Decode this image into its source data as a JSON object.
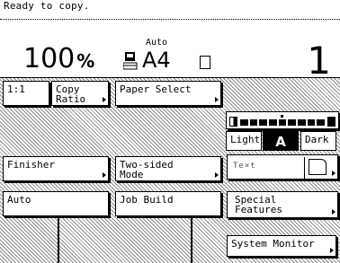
{
  "status": {
    "message": "Ready to copy."
  },
  "info": {
    "zoom_value": "100",
    "zoom_unit": "%",
    "paper_select_mode": "Auto",
    "paper_size": "A4",
    "copies": "1"
  },
  "buttons": {
    "one_to_one": "1:1",
    "copy_ratio": "Copy\nRatio",
    "paper_select": "Paper Select",
    "finisher": "Finisher",
    "two_sided_mode": "Two-sided\nMode",
    "auto": "Auto",
    "job_build": "Job Build",
    "special_features": "Special\nFeatures",
    "system_monitor": "System Monitor"
  },
  "exposure": {
    "light": "Light",
    "auto": "A",
    "dark": "Dark",
    "scale_levels": 9,
    "text_mode_label": "Te×t"
  }
}
